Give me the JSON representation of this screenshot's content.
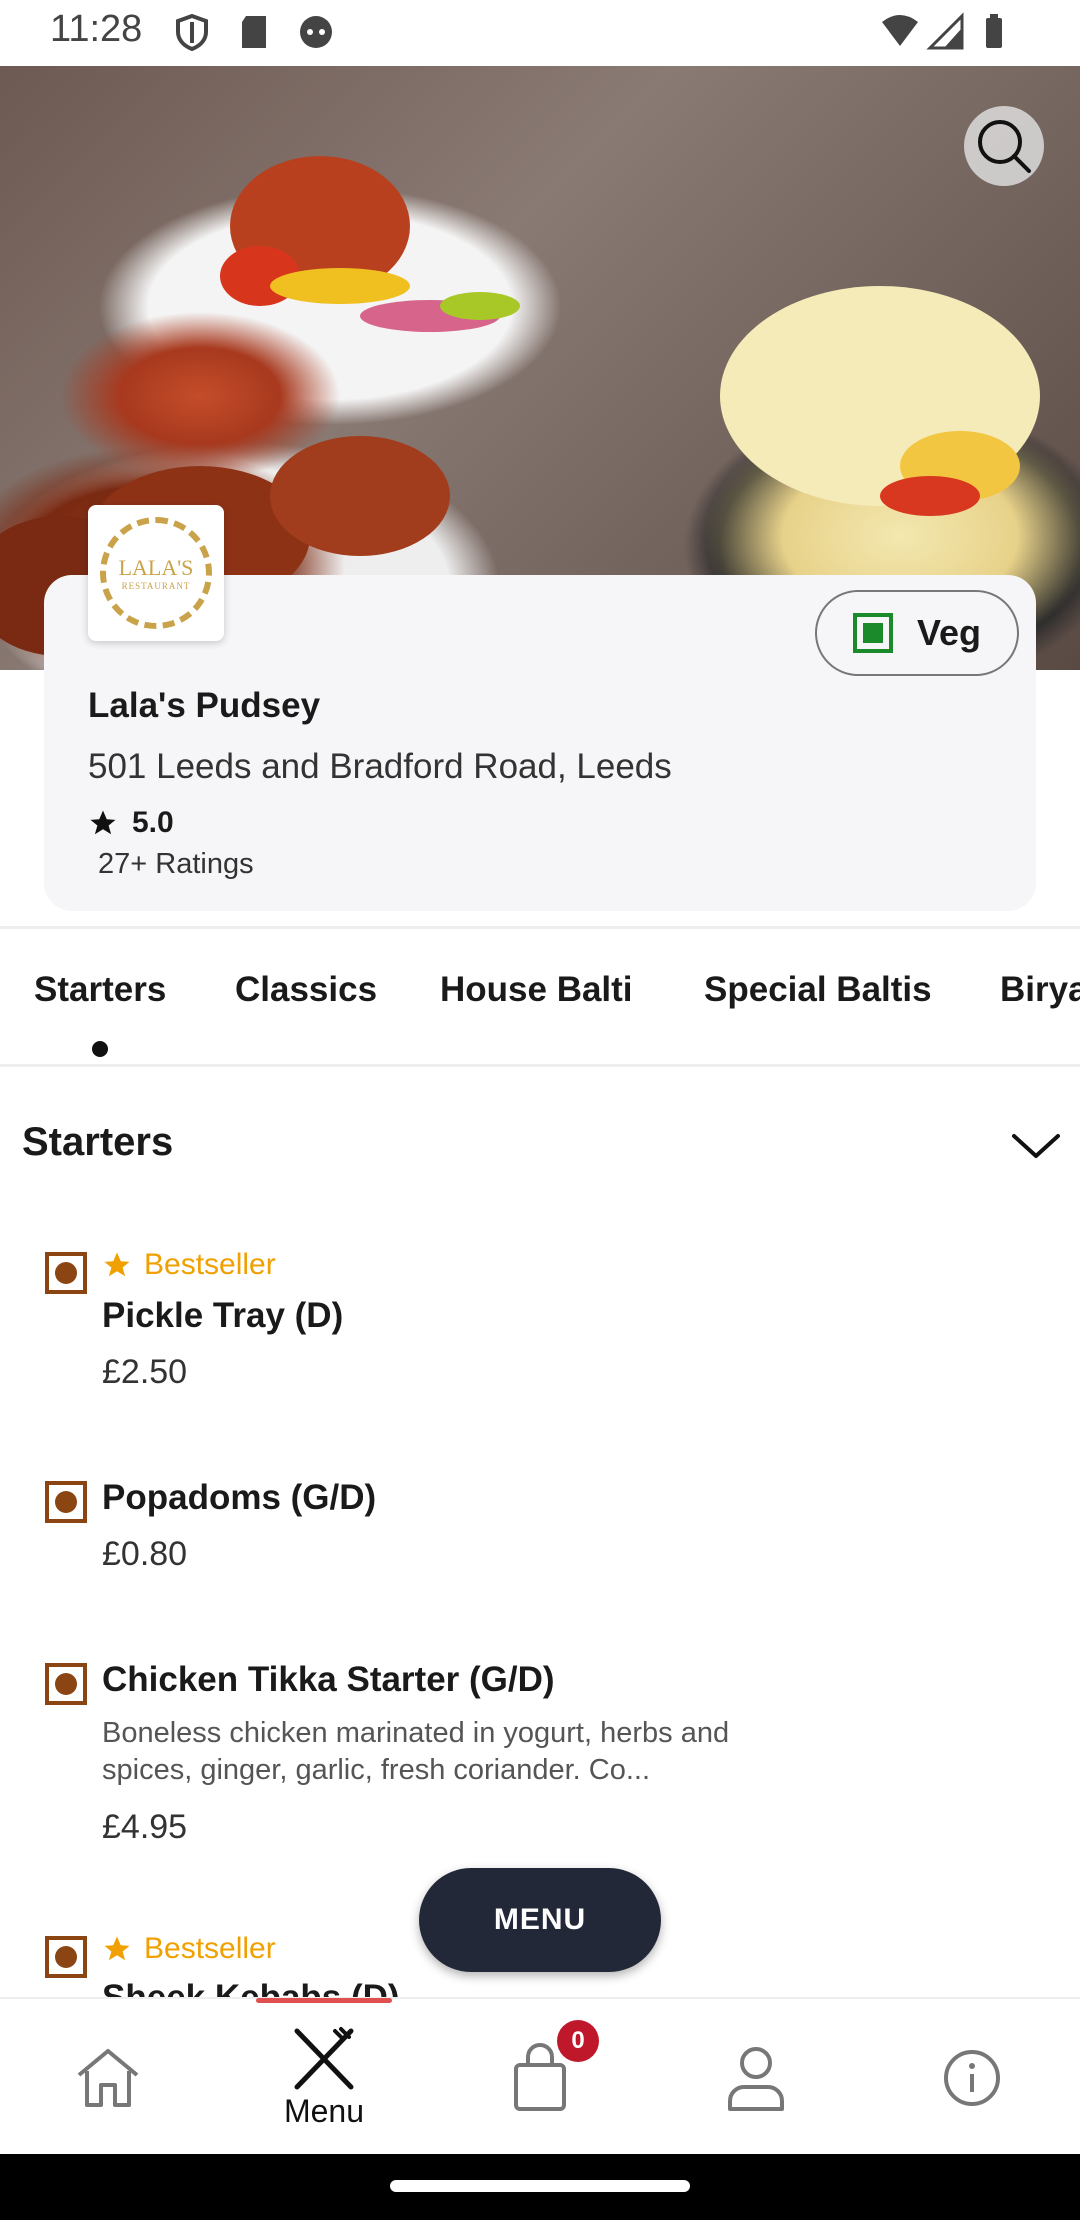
{
  "status_bar": {
    "time": "11:28",
    "icons": [
      "shield-icon",
      "sd-card-icon",
      "android-face-icon",
      "wifi-icon",
      "signal-icon",
      "battery-icon"
    ]
  },
  "hero": {
    "search_icon": "search-icon"
  },
  "restaurant": {
    "logo_text": "LALA'S",
    "logo_subtext": "RESTAURANT",
    "name": "Lala's Pudsey",
    "address": "501 Leeds and Bradford Road, Leeds",
    "rating": "5.0",
    "rating_count": "27+ Ratings",
    "veg_label": "Veg",
    "veg_color": "#1a8a2a"
  },
  "tabs": [
    {
      "label": "Starters",
      "active": true
    },
    {
      "label": "Classics"
    },
    {
      "label": "House Balti"
    },
    {
      "label": "Special Baltis"
    },
    {
      "label": "Biryani"
    }
  ],
  "section": {
    "title": "Starters"
  },
  "items": [
    {
      "bestseller": "Bestseller",
      "name": "Pickle Tray (D)",
      "price": "£2.50"
    },
    {
      "name": "Popadoms (G/D)",
      "price": "£0.80"
    },
    {
      "name": "Chicken Tikka Starter (G/D)",
      "description": "Boneless chicken marinated in yogurt, herbs and spices, ginger, garlic, fresh coriander. Co...",
      "price": "£4.95"
    },
    {
      "bestseller": "Bestseller",
      "name": "Sheek Kebabs (D)"
    }
  ],
  "menu_button": "MENU",
  "bottom_nav": {
    "home": "home-icon",
    "menu_label": "Menu",
    "cart_count": "0",
    "profile": "user-icon",
    "info": "info-icon"
  },
  "colors": {
    "accent": "#232838",
    "bestseller": "#f0a000",
    "nonveg": "#8b4513",
    "badge": "#c0182b"
  }
}
